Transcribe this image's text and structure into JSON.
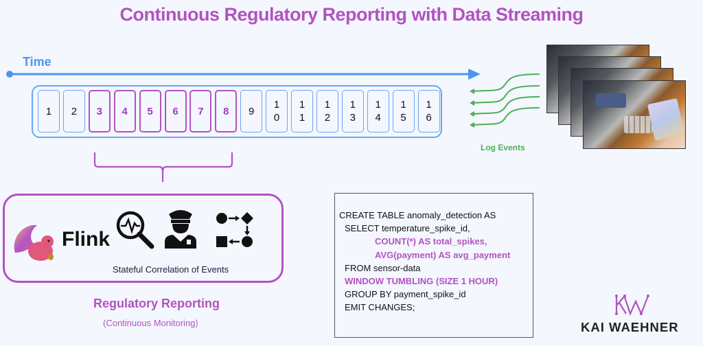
{
  "title": "Continuous Regulatory Reporting with Data Streaming",
  "timeline": {
    "label": "Time",
    "color": "#4a97ee"
  },
  "stream": {
    "events": [
      {
        "label": "1",
        "highlighted": false
      },
      {
        "label": "2",
        "highlighted": false
      },
      {
        "label": "3",
        "highlighted": true
      },
      {
        "label": "4",
        "highlighted": true
      },
      {
        "label": "5",
        "highlighted": true
      },
      {
        "label": "6",
        "highlighted": true
      },
      {
        "label": "7",
        "highlighted": true
      },
      {
        "label": "8",
        "highlighted": true
      },
      {
        "label": "9",
        "highlighted": false
      },
      {
        "label": "1\n0",
        "highlighted": false
      },
      {
        "label": "1\n1",
        "highlighted": false
      },
      {
        "label": "1\n2",
        "highlighted": false
      },
      {
        "label": "1\n3",
        "highlighted": false
      },
      {
        "label": "1\n4",
        "highlighted": false
      },
      {
        "label": "1\n5",
        "highlighted": false
      },
      {
        "label": "1\n6",
        "highlighted": false
      }
    ],
    "window_color": "#b352c0"
  },
  "source": {
    "label": "Log Events",
    "label_color": "#4cae55",
    "image": "payment-terminal-photo-stack",
    "image_count": 4
  },
  "processing": {
    "engine_name": "Flink",
    "engine_logo": "flink-squirrel-logo",
    "icons": [
      "monitoring-magnifier-icon",
      "police-officer-icon",
      "workflow-icon"
    ],
    "caption": "Stateful Correlation of Events",
    "title": "Regulatory Reporting",
    "subtitle": "(Continuous Monitoring)"
  },
  "sql": {
    "lines": [
      {
        "text": "CREATE TABLE anomaly_detection AS",
        "highlight": false
      },
      {
        "text": "SELECT temperature_spike_id,",
        "highlight": false
      },
      {
        "text": "COUNT(*) AS total_spikes,",
        "highlight": true
      },
      {
        "text": "AVG(payment) AS avg_payment",
        "highlight": true
      },
      {
        "text": "FROM sensor-data",
        "highlight": false
      },
      {
        "text": "WINDOW TUMBLING (SIZE 1 HOUR)",
        "highlight": true
      },
      {
        "text": "GROUP BY payment_spike_id",
        "highlight": false
      },
      {
        "text": "EMIT CHANGES;",
        "highlight": false
      }
    ]
  },
  "branding": {
    "monogram": "KW",
    "name": "KAI WAEHNER"
  },
  "colors": {
    "accent_purple": "#b352c0",
    "stream_blue": "#6aa6ee",
    "log_green": "#4cae55",
    "background": "#f4f7fe"
  }
}
